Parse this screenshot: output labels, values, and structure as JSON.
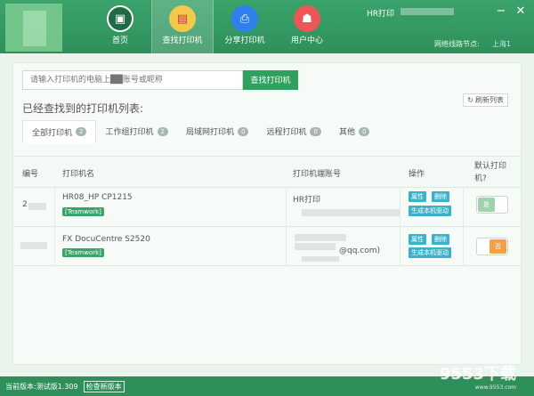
{
  "header": {
    "nav": [
      {
        "label": "首页",
        "icon": "home-icon",
        "color": "#2f8f5b",
        "glyph": "▣"
      },
      {
        "label": "查找打印机",
        "icon": "find-printer-icon",
        "color": "#f2c94c",
        "glyph": "▤"
      },
      {
        "label": "分享打印机",
        "icon": "share-printer-icon",
        "color": "#2f80ed",
        "glyph": "⎙"
      },
      {
        "label": "用户中心",
        "icon": "user-center-icon",
        "color": "#eb5757",
        "glyph": "☗"
      }
    ],
    "title": "HR打印",
    "node_label": "网络线路节点:",
    "node_value": "上海1",
    "minimize": "−",
    "close": "✕"
  },
  "search": {
    "placeholder": "请输入打印机的电脑上██账号或昵称",
    "button": "查找打印机"
  },
  "list_title": "已经查找到的打印机列表:",
  "refresh": "刷新列表",
  "tabs": [
    {
      "label": "全部打印机",
      "count": "2"
    },
    {
      "label": "工作组打印机",
      "count": "2"
    },
    {
      "label": "局域网打印机",
      "count": "0"
    },
    {
      "label": "远程打印机",
      "count": "0"
    },
    {
      "label": "其他",
      "count": "0"
    }
  ],
  "table": {
    "headers": {
      "num": "编号",
      "name": "打印机名",
      "account": "打印机端账号",
      "ops": "操作",
      "default": "默认打印机?"
    },
    "rows": [
      {
        "num": "2",
        "name": "HR08_HP CP1215",
        "tag": "[Teamwork]",
        "account": "HR打印",
        "ops": [
          "属性",
          "删除",
          "生成本机驱动"
        ],
        "default": "是"
      },
      {
        "num": "",
        "name": "FX DocuCentre S2520",
        "tag": "[Teamwork]",
        "account": "@qq.com)",
        "ops": [
          "属性",
          "删除",
          "生成本机驱动"
        ],
        "default": "否"
      }
    ]
  },
  "status": {
    "version": "当前版本:测试版1.309",
    "check": "检查新版本"
  },
  "watermark": {
    "main": "9553下载",
    "sub": "www.9553.com"
  }
}
